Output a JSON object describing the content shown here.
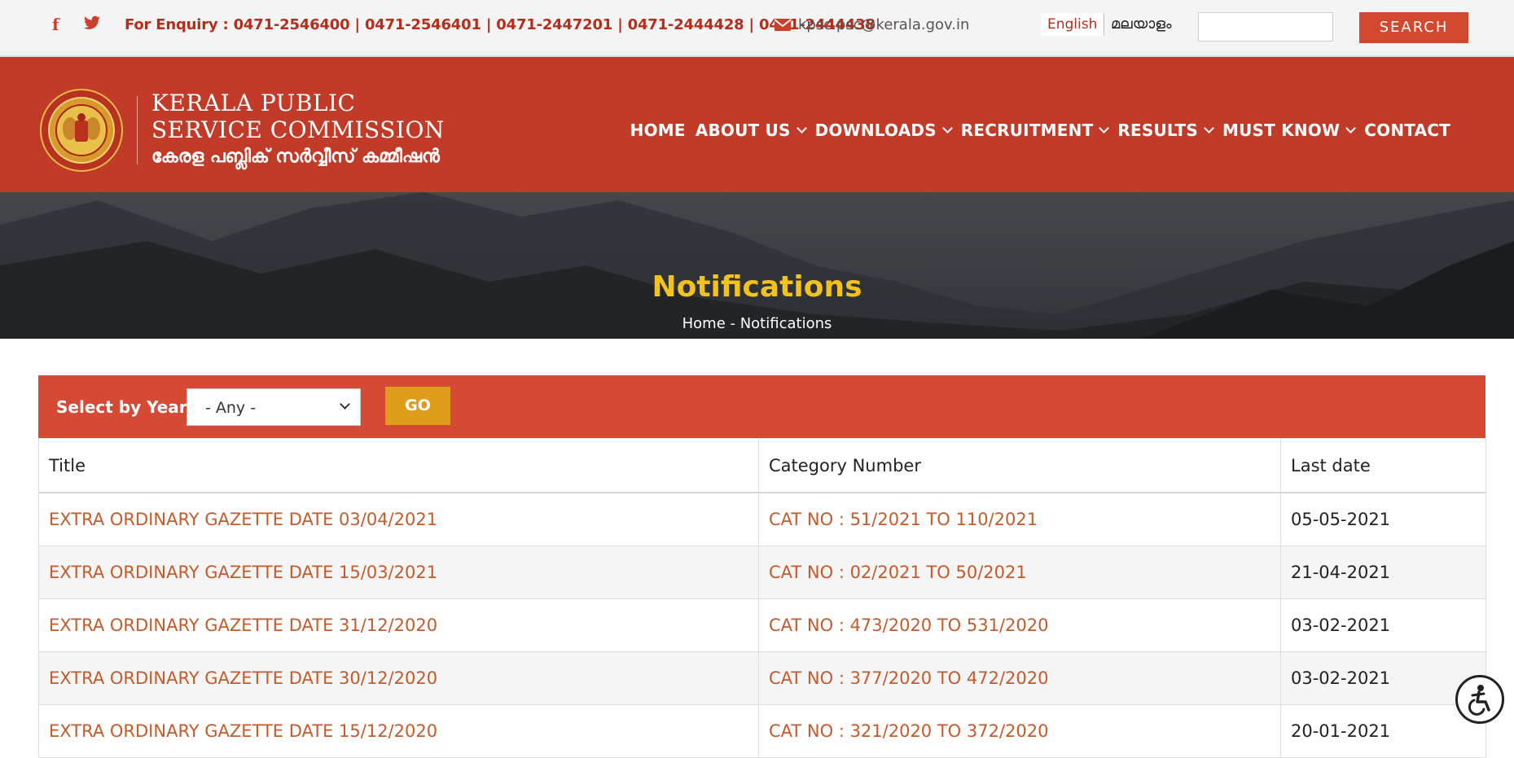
{
  "topbar": {
    "enquiry": "For Enquiry : 0471-2546400 | 0471-2546401 | 0471-2447201 | 0471-2444428 | 0471-2444438",
    "email": "kpsc.psc@kerala.gov.in",
    "lang_english": "English",
    "lang_malayalam": "മലയാളം",
    "search_value": "",
    "search_button": "SEARCH",
    "facebook_icon": "f"
  },
  "header": {
    "org_name_line1": "KERALA PUBLIC",
    "org_name_line2": "SERVICE COMMISSION",
    "org_name_ml": "കേരള പബ്ലിക് സർവ്വീസ് കമ്മീഷൻ",
    "nav": [
      {
        "label": "HOME",
        "dropdown": false
      },
      {
        "label": "ABOUT US",
        "dropdown": true
      },
      {
        "label": "DOWNLOADS",
        "dropdown": true
      },
      {
        "label": "RECRUITMENT",
        "dropdown": true
      },
      {
        "label": "RESULTS",
        "dropdown": true
      },
      {
        "label": "MUST KNOW",
        "dropdown": true
      },
      {
        "label": "CONTACT",
        "dropdown": false
      }
    ]
  },
  "banner": {
    "title": "Notifications",
    "breadcrumb": "Home - Notifications"
  },
  "filter": {
    "label": "Select by Year",
    "selected": "- Any -",
    "go": "GO"
  },
  "table": {
    "headers": [
      "Title",
      "Category Number",
      "Last date"
    ],
    "rows": [
      {
        "title": "EXTRA ORDINARY GAZETTE DATE 03/04/2021",
        "category": "CAT NO : 51/2021 TO 110/2021",
        "last_date": "05-05-2021"
      },
      {
        "title": "EXTRA ORDINARY GAZETTE DATE 15/03/2021",
        "category": "CAT NO : 02/2021 TO 50/2021",
        "last_date": "21-04-2021"
      },
      {
        "title": "EXTRA ORDINARY GAZETTE DATE 31/12/2020",
        "category": "CAT NO : 473/2020 TO 531/2020",
        "last_date": "03-02-2021"
      },
      {
        "title": "EXTRA ORDINARY GAZETTE DATE 30/12/2020",
        "category": "CAT NO : 377/2020 TO 472/2020",
        "last_date": "03-02-2021"
      },
      {
        "title": "EXTRA ORDINARY GAZETTE DATE 15/12/2020",
        "category": "CAT NO : 321/2020 TO 372/2020",
        "last_date": "20-01-2021"
      }
    ]
  },
  "colors": {
    "header_red": "#c23b28",
    "filter_red": "#d44a34",
    "title_yellow": "#f2c21d",
    "go_orange": "#e09c1b",
    "link_orange": "#c55a2a"
  },
  "icons": {
    "facebook": "facebook-icon",
    "twitter": "twitter-icon",
    "mail": "mail-icon",
    "accessibility": "accessibility-icon",
    "logo": "kpsc-emblem-logo"
  }
}
